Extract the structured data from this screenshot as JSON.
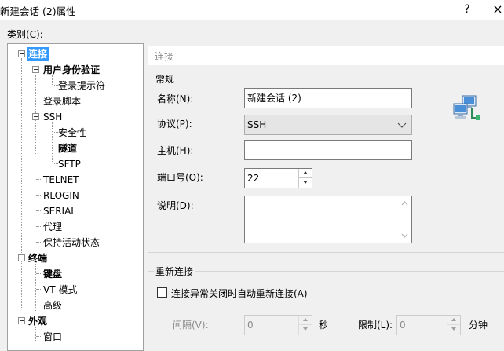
{
  "window": {
    "title": "新建会话 (2)属性",
    "help": "?",
    "close": "×"
  },
  "category_label": "类别(C):",
  "tree": {
    "items": [
      {
        "label": "连接"
      },
      {
        "label": "用户身份验证"
      },
      {
        "label": "登录提示符"
      },
      {
        "label": "登录脚本"
      },
      {
        "label": "SSH"
      },
      {
        "label": "安全性"
      },
      {
        "label": "隧道"
      },
      {
        "label": "SFTP"
      },
      {
        "label": "TELNET"
      },
      {
        "label": "RLOGIN"
      },
      {
        "label": "SERIAL"
      },
      {
        "label": "代理"
      },
      {
        "label": "保持活动状态"
      },
      {
        "label": "终端"
      },
      {
        "label": "键盘"
      },
      {
        "label": "VT 模式"
      },
      {
        "label": "高级"
      },
      {
        "label": "外观"
      },
      {
        "label": "窗口"
      }
    ]
  },
  "header": {
    "title": "连接"
  },
  "general": {
    "title": "常规",
    "name_label": "名称(N):",
    "name_value": "新建会话 (2)",
    "protocol_label": "协议(P):",
    "protocol_value": "SSH",
    "host_label": "主机(H):",
    "host_value": "",
    "port_label": "端口号(O):",
    "port_value": "22",
    "desc_label": "说明(D):",
    "desc_value": ""
  },
  "reconnect": {
    "title": "重新连接",
    "checkbox_label": "连接异常关闭时自动重新连接(A)",
    "checked": false,
    "interval_label": "间隔(V):",
    "interval_value": "0",
    "interval_unit": "秒",
    "limit_label": "限制(L):",
    "limit_value": "0",
    "limit_unit": "分钟"
  },
  "icons": {
    "session_icon": "network-computers-icon"
  },
  "colors": {
    "selection": "#3399ff"
  }
}
